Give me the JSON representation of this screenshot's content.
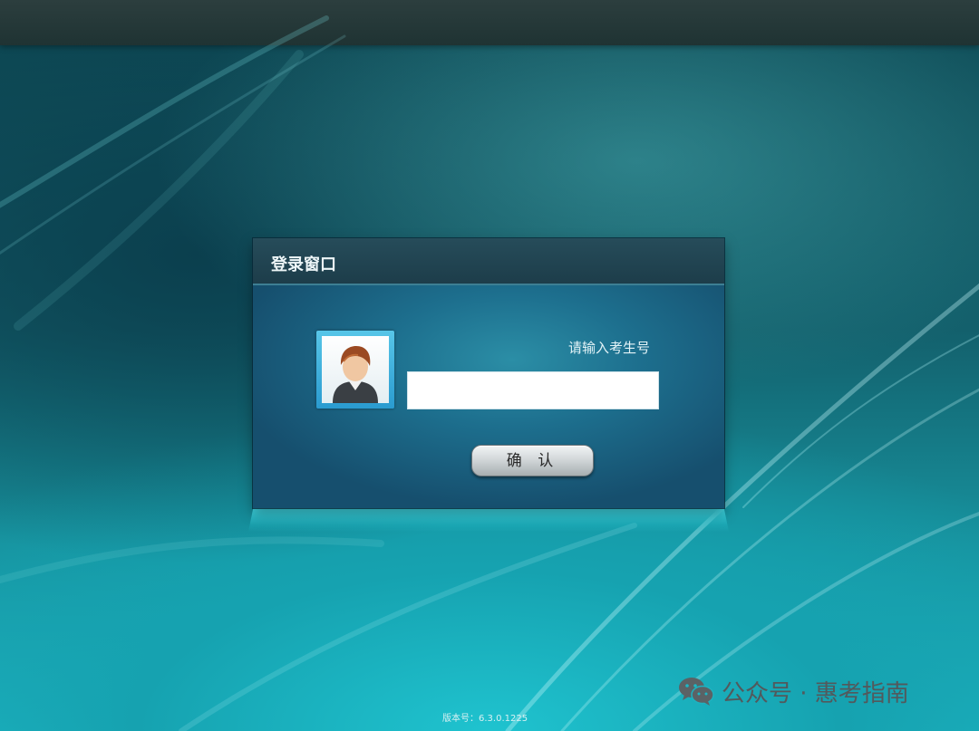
{
  "window": {
    "title": "登录窗口"
  },
  "login": {
    "prompt": "请输入考生号",
    "input_value": "",
    "confirm_label": "确 认"
  },
  "footer": {
    "version": "版本号：6.3.0.1225"
  },
  "watermark": {
    "text": "公众号 · 惠考指南",
    "icon": "wechat-icon"
  },
  "colors": {
    "background_accent": "#1cb7c4",
    "dialog_body": "#1d6f8e",
    "dialog_header": "#264c5a"
  }
}
